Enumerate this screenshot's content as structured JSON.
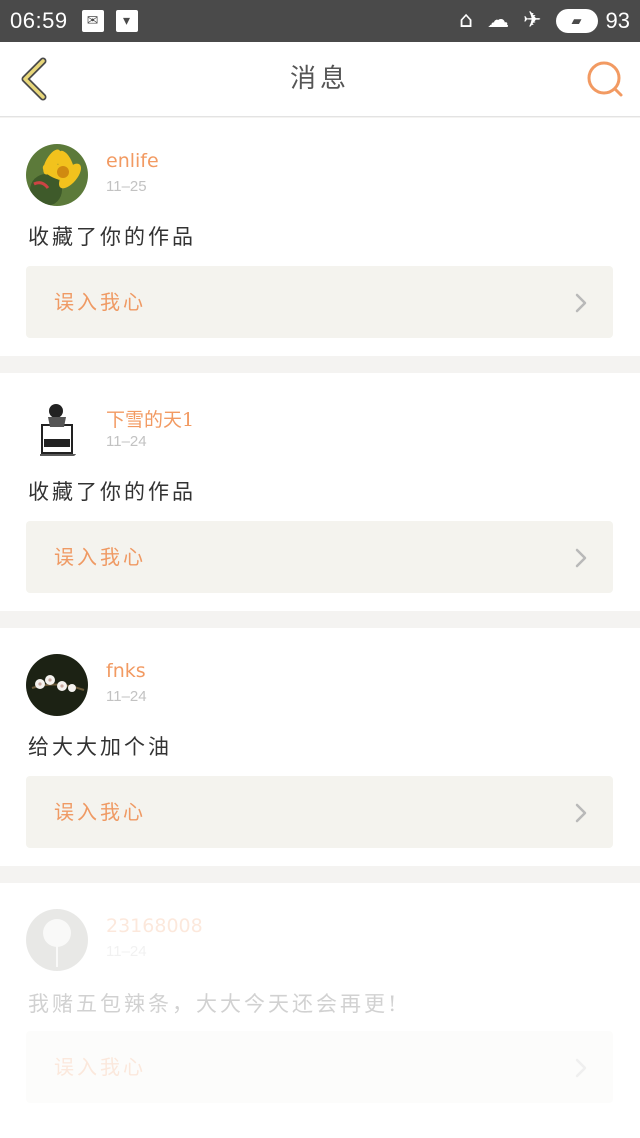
{
  "status_bar": {
    "time": "06:59",
    "battery_level": "93"
  },
  "header": {
    "title": "消息"
  },
  "colors": {
    "accent": "#f29a62",
    "back_arrow": "#e8d77a",
    "link_bg": "#f4f3ee"
  },
  "icons": {
    "back": "chevron-left-icon",
    "search": "search-icon",
    "work_link": "chevron-right-icon"
  },
  "notifications": [
    {
      "user": "enlife",
      "date": "11–25",
      "message": "收藏了你的作品",
      "work_title": "误入我心"
    },
    {
      "user": "下雪的天1",
      "date": "11–24",
      "message": "收藏了你的作品",
      "work_title": "误入我心"
    },
    {
      "user": "fnks",
      "date": "11–24",
      "message": "给大大加个油",
      "work_title": "误入我心"
    },
    {
      "user": "23168008",
      "date": "11–24",
      "message": "我赌五包辣条，大大今天还会再更!",
      "work_title": "误入我心"
    }
  ]
}
